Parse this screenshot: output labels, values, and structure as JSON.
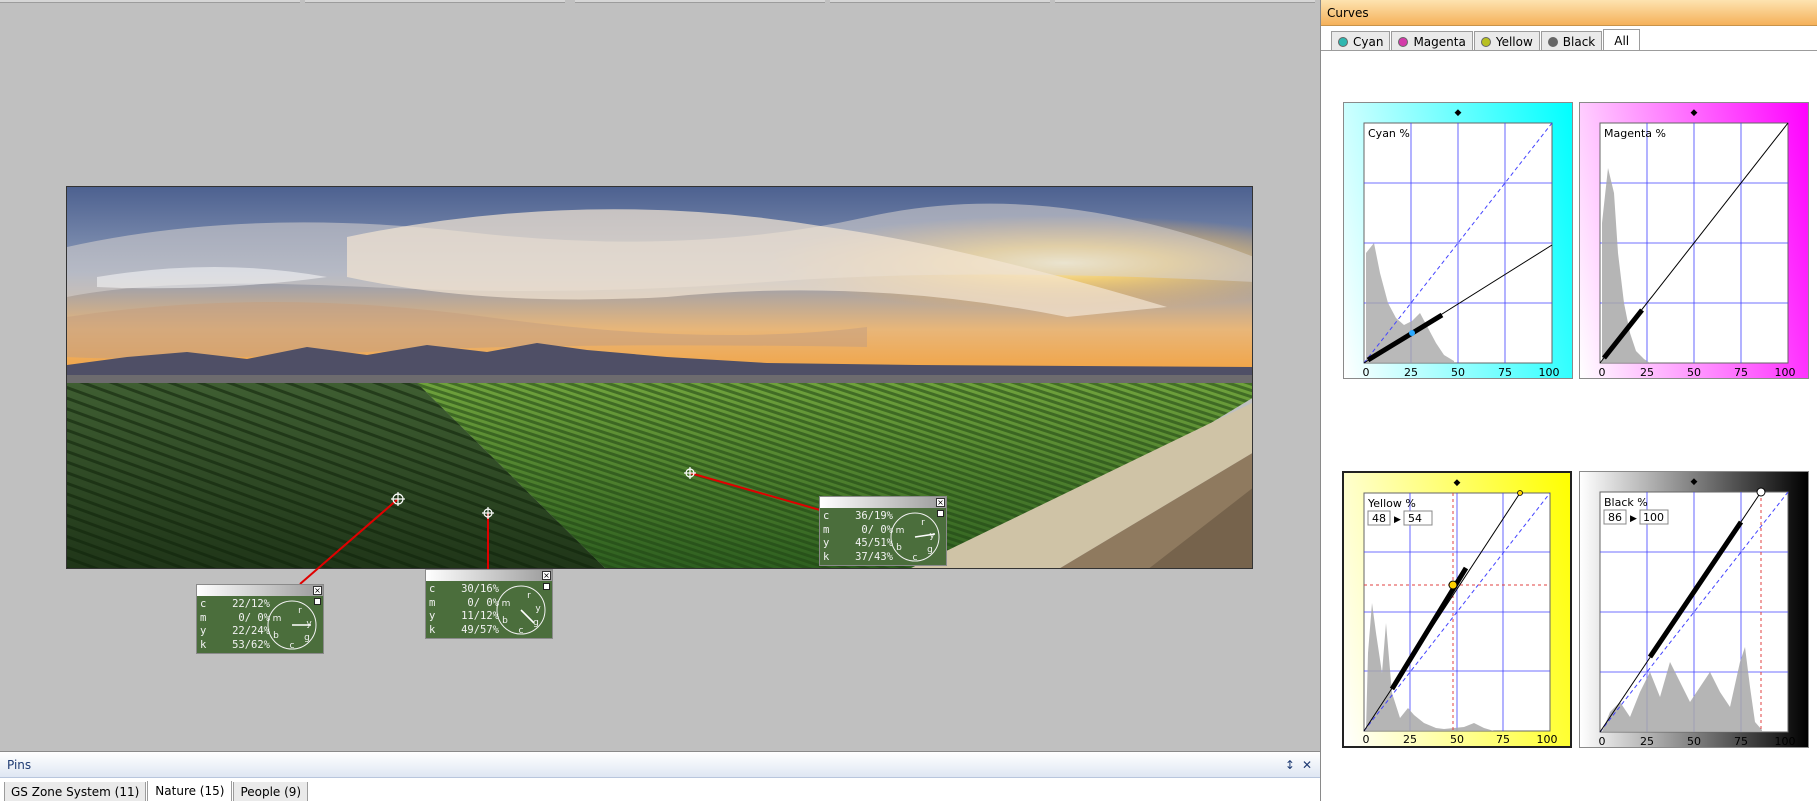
{
  "canvas": {
    "pins": [
      {
        "id": "pin-1",
        "c": "22/12%",
        "m": "0/ 0%",
        "y": "22/24%",
        "k": "53/62%"
      },
      {
        "id": "pin-2",
        "c": "30/16%",
        "m": "0/ 0%",
        "y": "11/12%",
        "k": "49/57%"
      },
      {
        "id": "pin-3",
        "c": "36/19%",
        "m": "0/ 0%",
        "y": "45/51%",
        "k": "37/43%"
      }
    ],
    "channel_letters": {
      "c": "c",
      "m": "m",
      "y": "y",
      "k": "k"
    },
    "wheel_letters": {
      "r": "r",
      "y": "y",
      "g": "g",
      "c": "c",
      "b": "b",
      "m": "m"
    }
  },
  "curves": {
    "title": "Curves",
    "tabs": [
      {
        "label": "Cyan",
        "color": "#2fb7b0"
      },
      {
        "label": "Magenta",
        "color": "#d33aa9"
      },
      {
        "label": "Yellow",
        "color": "#b8c020"
      },
      {
        "label": "Black",
        "color": "#666666"
      },
      {
        "label": "All",
        "color": ""
      }
    ],
    "axis_ticks": [
      "0",
      "25",
      "50",
      "75",
      "100"
    ],
    "graphs": {
      "cyan": {
        "label": "Cyan %",
        "color": "#00ffff"
      },
      "magenta": {
        "label": "Magenta %",
        "color": "#ff00ff"
      },
      "yellow": {
        "label": "Yellow %",
        "color": "#ffff00",
        "input": "48",
        "output": "54"
      },
      "black": {
        "label": "Black %",
        "color": "#000000",
        "input": "86",
        "output": "100"
      }
    },
    "arrow_glyph": "▶"
  },
  "pins_panel": {
    "title": "Pins",
    "pin_glyph": "↕",
    "close_glyph": "✕",
    "tabs": [
      {
        "label": "GS Zone System (11)"
      },
      {
        "label": "Nature (15)"
      },
      {
        "label": "People (9)"
      }
    ]
  },
  "colors": {
    "pin_card_bg": "#4b6e3c",
    "pin_line": "#e00000",
    "curves_title_bg": "#f5b15a",
    "pins_title_text": "#1f3b73"
  }
}
